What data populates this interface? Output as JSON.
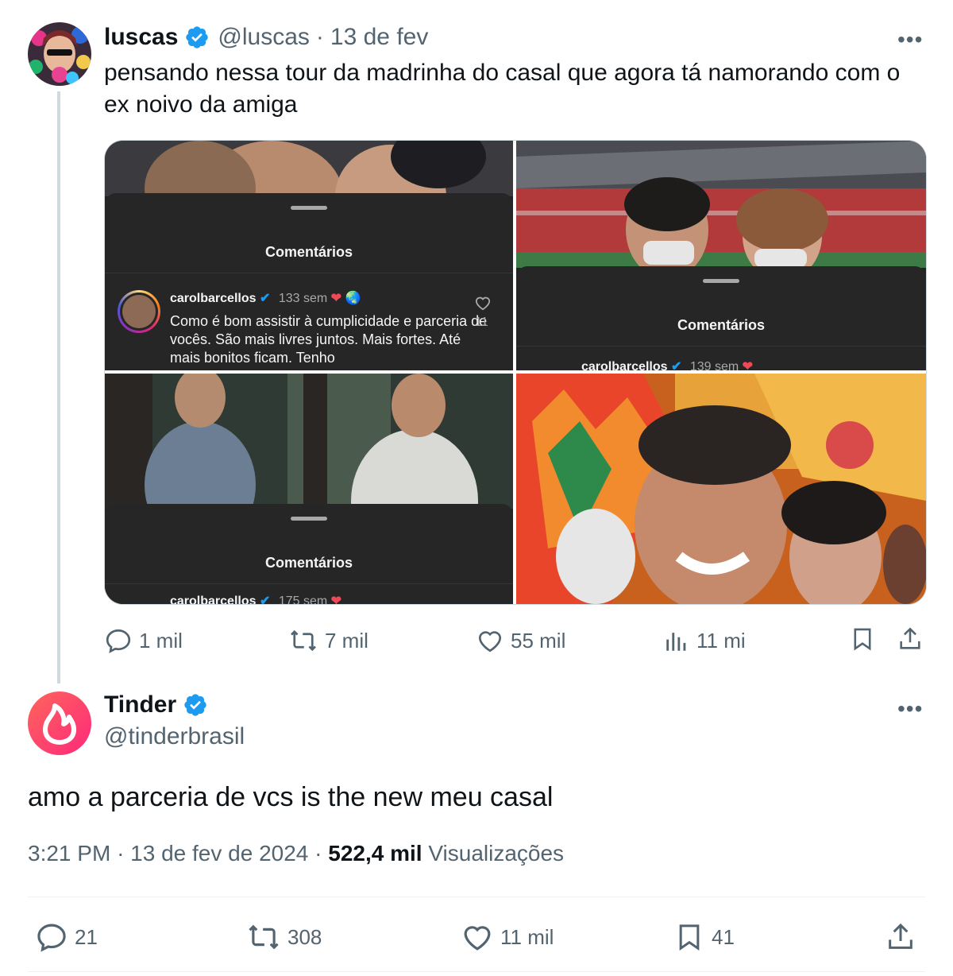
{
  "parent_tweet": {
    "display_name": "luscas",
    "handle": "@luscas",
    "separator": "·",
    "date": "13 de fev",
    "more_icon": "more-horizontal-icon",
    "text": "pensando nessa tour da madrinha do casal que agora tá namorando com o ex noivo da amiga",
    "media": {
      "sheet_title": "Comentários",
      "top_left_comment": {
        "username": "carolbarcellos",
        "time": "133 sem",
        "text": "Como é bom assistir à cumplicidade e parceria de vocês. São mais livres juntos. Mais fortes. Até mais bonitos ficam. Tenho",
        "likes": "11"
      },
      "top_right_comment": {
        "username": "carolbarcellos",
        "time": "139 sem"
      },
      "bottom_left_comment": {
        "username": "carolbarcellos",
        "time": "175 sem"
      }
    },
    "actions": {
      "replies": "1 mil",
      "reposts": "7 mil",
      "likes": "55 mil",
      "views": "11 mi"
    }
  },
  "reply_tweet": {
    "display_name": "Tinder",
    "handle": "@tinderbrasil",
    "text": "amo a parceria de vcs is the new meu casal",
    "time": "3:21 PM",
    "separator": "·",
    "date": "13 de fev de 2024",
    "separator2": "·",
    "views_count": "522,4 mil",
    "views_label": "Visualizações",
    "actions": {
      "replies": "21",
      "reposts": "308",
      "likes": "11 mil",
      "bookmarks": "41"
    }
  },
  "colors": {
    "verified": "#1d9bf0",
    "text": "#0f1419",
    "muted": "#536471",
    "tinder_gradient_start": "#fd297b",
    "tinder_gradient_end": "#ff655b"
  }
}
